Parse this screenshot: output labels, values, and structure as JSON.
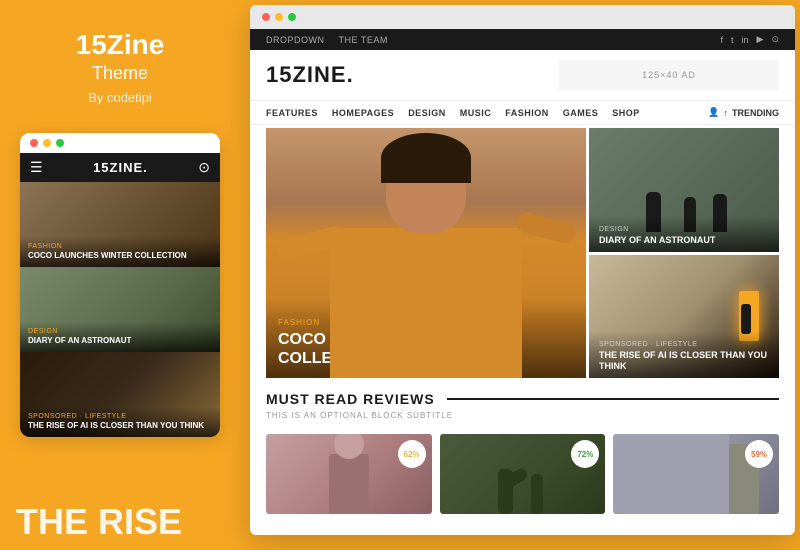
{
  "left": {
    "title": "15Zine",
    "subtitle": "Theme",
    "byline": "By codetipi",
    "phone": {
      "nav_title": "15ZINE.",
      "cards": [
        {
          "category": "FASHION",
          "title": "COCO LAUNCHES WINTER COLLECTION",
          "bg_class": "card-fashion"
        },
        {
          "category": "DESIGN",
          "title": "DIARY OF AN ASTRONAUT",
          "bg_class": "card-design"
        },
        {
          "category": "SPONSORED · LIFESTYLE",
          "title": "THE RISE OF AI IS CLOSER THAN YOU THINK",
          "bg_class": "card-ai"
        }
      ]
    },
    "bottom_text": "ThE RISE"
  },
  "browser": {
    "topbar": {
      "nav_items": [
        "DROPDOWN",
        "THE TEAM"
      ],
      "social_icons": [
        "f",
        "t",
        "in",
        "yt",
        "🔍"
      ]
    },
    "logo": "15ZINE.",
    "ad_text": "125×40 AD",
    "nav_links": [
      "FEATURES",
      "HOMEPAGES",
      "DESIGN",
      "MUSIC",
      "FASHION",
      "GAMES",
      "SHOP"
    ],
    "trending_label": "TRENDING",
    "hero": {
      "main": {
        "category": "FASHION",
        "title": "COCO LAUNCHES WINTER COLLECTION"
      },
      "side_cards": [
        {
          "category": "DESIGN",
          "title": "DIARY OF AN ASTRONAUT",
          "bg_class": "dark"
        },
        {
          "category": "SPONSORED · LIFESTYLE",
          "title": "THE RISE OF AI IS CLOSER THAN YOU THINK",
          "bg_class": "room"
        }
      ]
    },
    "must_read": {
      "title": "MUST READ REVIEWS",
      "subtitle": "THIS IS AN OPTIONAL BLOCK SUBTITLE",
      "articles": [
        {
          "score": "62%",
          "bg_class": "img1",
          "score_class": "s1"
        },
        {
          "score": "72%",
          "bg_class": "img2",
          "score_class": "s2"
        },
        {
          "score": "59%",
          "bg_class": "img3",
          "score_class": "s3"
        }
      ]
    }
  }
}
